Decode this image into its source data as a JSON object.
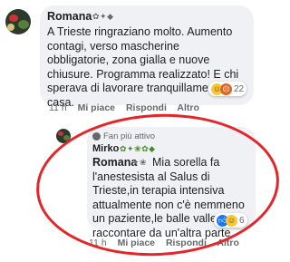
{
  "comment1": {
    "author": "Romana",
    "text_lines": [
      "A Trieste ringraziano molto. Aumento",
      "contagi, verso mascherine",
      "obbligatorie, zona gialla e nuove",
      "chiusure. Programma realizzato! E chi",
      "sperava di lavorare tranquillamente, a",
      "casa."
    ],
    "time": "11 h",
    "like": "Mi piace",
    "reply": "Rispondi",
    "more": "Altro",
    "reaction_count": "22"
  },
  "comment2": {
    "badge": "Fan più attivo",
    "author": "Mirko",
    "author_line2": "Romana",
    "text_lines": [
      "Mia sorella fa",
      "l'anestesista al Salus di",
      "Trieste,in terapia intensiva",
      "attualmente non c'è nemmeno",
      "un paziente,le balle valle a",
      "raccontare da un'altra parte"
    ],
    "time": "11 h",
    "like": "Mi piace",
    "reply": "Rispondi",
    "more": "Altro",
    "reaction_count": "6"
  }
}
